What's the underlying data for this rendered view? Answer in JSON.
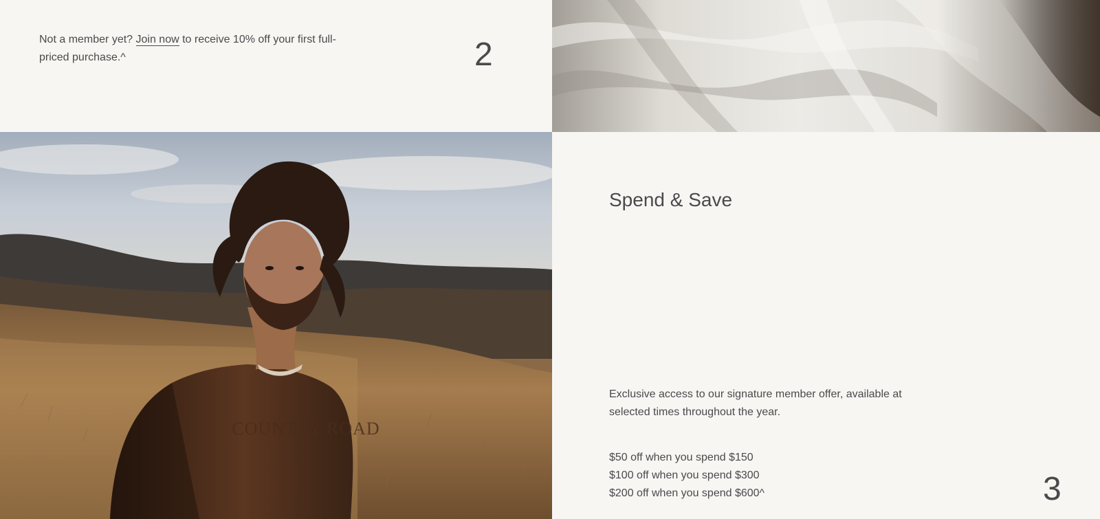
{
  "member_section": {
    "text_before": "Not a member yet? ",
    "join_link_label": "Join now",
    "text_after": " to receive 10% off your first full-priced purchase.^",
    "step_number": "2"
  },
  "spend_save": {
    "title": "Spend & Save",
    "description": "Exclusive access to our signature member offer, available at selected times throughout the year.",
    "offers": [
      "$50 off when you spend $150",
      "$100 off when you spend $300",
      "$200 off when you spend $600^"
    ],
    "step_number": "3"
  },
  "images": {
    "linen": "linen-bedding-photo",
    "portrait": "man-in-field-photo",
    "sweater_print": "COUNTRY ROAD"
  },
  "colors": {
    "background": "#f7f6f3",
    "text": "#4a4a4c"
  }
}
